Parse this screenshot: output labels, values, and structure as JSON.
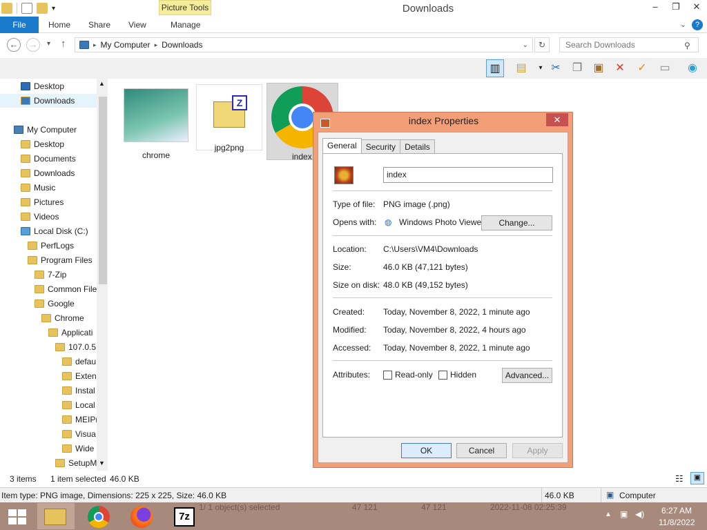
{
  "window": {
    "title": "Downloads",
    "context_tab": "Picture Tools"
  },
  "ribbon": {
    "file": "File",
    "tabs": [
      "Home",
      "Share",
      "View",
      "Manage"
    ]
  },
  "address": {
    "path": [
      "My Computer",
      "Downloads"
    ]
  },
  "search": {
    "placeholder": "Search Downloads"
  },
  "nav": {
    "favorites": [
      "Desktop",
      "Downloads"
    ],
    "computer": "My Computer",
    "items": [
      "Desktop",
      "Documents",
      "Downloads",
      "Music",
      "Pictures",
      "Videos",
      "Local Disk (C:)",
      "PerfLogs",
      "Program Files",
      "7-Zip",
      "Common File",
      "Google",
      "Chrome",
      "Applicati",
      "107.0.5",
      "defau",
      "Exten",
      "Instal",
      "Local",
      "MEIPr",
      "Visua",
      "Wide",
      "SetupM"
    ]
  },
  "files": [
    {
      "name": "chrome"
    },
    {
      "name": "jpg2png"
    },
    {
      "name": "index"
    }
  ],
  "status": {
    "count": "3 items",
    "selected": "1 item selected",
    "size": "46.0 KB"
  },
  "statusbar": {
    "info": "Item type: PNG image, Dimensions: 225 x 225, Size: 46.0 KB",
    "size": "46.0 KB",
    "location": "Computer"
  },
  "taskbar": {
    "selected": "1/ 1 object(s) selected",
    "v1": "47 121",
    "v2": "47 121",
    "date": "2022-11-08 02:25:39",
    "time": "6:27 AM",
    "day": "11/8/2022"
  },
  "dialog": {
    "title": "index Properties",
    "tabs": [
      "General",
      "Security",
      "Details"
    ],
    "filename": "index",
    "type_label": "Type of file:",
    "type_value": "PNG image (.png)",
    "opens_label": "Opens with:",
    "opens_value": "Windows Photo Viewer",
    "change_btn": "Change...",
    "location_label": "Location:",
    "location_value": "C:\\Users\\VM4\\Downloads",
    "size_label": "Size:",
    "size_value": "46.0 KB (47,121 bytes)",
    "sizeondisk_label": "Size on disk:",
    "sizeondisk_value": "48.0 KB (49,152 bytes)",
    "created_label": "Created:",
    "created_value": "Today, November 8, 2022, 1 minute ago",
    "modified_label": "Modified:",
    "modified_value": "Today, November 8, 2022, 4 hours ago",
    "accessed_label": "Accessed:",
    "accessed_value": "Today, November 8, 2022, 1 minute ago",
    "attributes_label": "Attributes:",
    "readonly": "Read-only",
    "hidden": "Hidden",
    "advanced_btn": "Advanced...",
    "ok": "OK",
    "cancel": "Cancel",
    "apply": "Apply"
  }
}
